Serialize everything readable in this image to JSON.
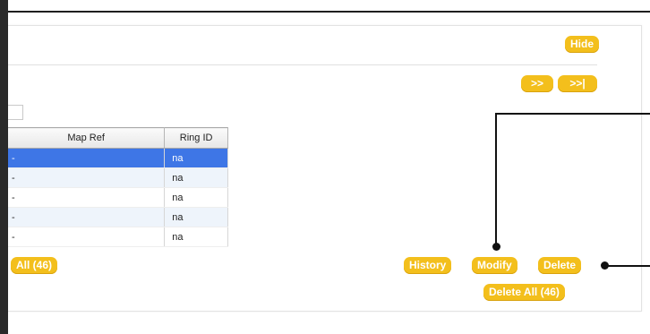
{
  "header": {
    "hide_label": "Hide"
  },
  "pager": {
    "next_label": ">>",
    "last_label": ">>|"
  },
  "table": {
    "columns": [
      "Map Ref",
      "Ring ID"
    ],
    "rows": [
      {
        "map_ref": "-",
        "ring_id": "na",
        "selected": true
      },
      {
        "map_ref": "-",
        "ring_id": "na"
      },
      {
        "map_ref": "-",
        "ring_id": "na"
      },
      {
        "map_ref": "-",
        "ring_id": "na"
      },
      {
        "map_ref": "-",
        "ring_id": "na"
      }
    ]
  },
  "footer": {
    "select_all_label": "All (46)",
    "history_label": "History",
    "modify_label": "Modify",
    "delete_label": "Delete",
    "delete_all_label": "Delete All (46)"
  },
  "colors": {
    "button": "#f3bf1c",
    "selected_row": "#3e76e6",
    "alt_row": "#eef4fb"
  }
}
